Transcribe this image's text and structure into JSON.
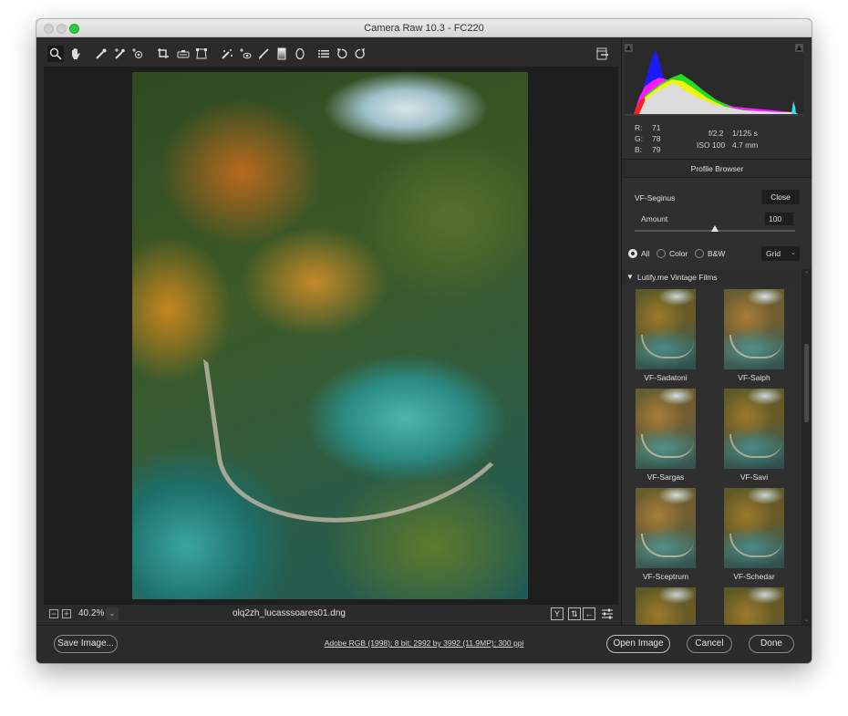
{
  "window": {
    "title": "Camera Raw 10.3  -  FC220"
  },
  "toolbar": {
    "tools": [
      {
        "name": "zoom-tool",
        "glyph": "🔍︎",
        "active": true
      },
      {
        "name": "hand-tool",
        "glyph": "✋︎"
      },
      {
        "name": "white-balance-tool",
        "glyph": "⁄"
      },
      {
        "name": "color-sampler-tool",
        "glyph": "⁄"
      },
      {
        "name": "targeted-adjustment-tool",
        "glyph": "⊙"
      },
      {
        "name": "crop-tool",
        "glyph": "⌗"
      },
      {
        "name": "straighten-tool",
        "glyph": "▭"
      },
      {
        "name": "transform-tool",
        "glyph": "⌑"
      },
      {
        "name": "spot-removal-tool",
        "glyph": "⁄"
      },
      {
        "name": "red-eye-tool",
        "glyph": "+o"
      },
      {
        "name": "adjustment-brush-tool",
        "glyph": "/"
      },
      {
        "name": "graduated-filter-tool",
        "glyph": "▮"
      },
      {
        "name": "radial-filter-tool",
        "glyph": "◯"
      },
      {
        "name": "preferences-tool",
        "glyph": "☰"
      },
      {
        "name": "rotate-left-tool",
        "glyph": "↺"
      },
      {
        "name": "rotate-right-tool",
        "glyph": "↻"
      }
    ],
    "toggle_fullscreen_glyph": "⇥"
  },
  "preview": {
    "zoom_out_glyph": "−",
    "zoom_in_glyph": "+",
    "zoom_level": "40.2%",
    "zoom_dropdown_glyph": "⌄",
    "filename": "olq2zh_lucasssoares01.dng",
    "view_buttons": [
      {
        "name": "before-after-view-button",
        "glyph": "Y"
      },
      {
        "name": "swap-before-after-button",
        "glyph": "⇅"
      },
      {
        "name": "copy-settings-button",
        "glyph": "←"
      },
      {
        "name": "toggle-settings-button",
        "glyph": "☷"
      }
    ]
  },
  "histogram": {
    "shadow_clip_glyph": "▲",
    "highlight_clip_glyph": "▲"
  },
  "readout": {
    "r_label": "R:",
    "r_value": "71",
    "g_label": "G:",
    "g_value": "78",
    "b_label": "B:",
    "b_value": "79",
    "aperture": "f/2.2",
    "shutter": "1/125 s",
    "iso": "ISO 100",
    "focal_length": "4.7 mm"
  },
  "profile_browser": {
    "title": "Profile Browser",
    "profile_name": "VF-Seginus",
    "close_label": "Close",
    "amount_label": "Amount",
    "amount_value": "100",
    "amount_fraction": 0.5,
    "filters": [
      {
        "label": "All",
        "checked": true
      },
      {
        "label": "Color",
        "checked": false
      },
      {
        "label": "B&W",
        "checked": false
      }
    ],
    "view_mode": "Grid",
    "view_mode_chevron": "⌄",
    "group": {
      "expand_glyph": "▼",
      "label": "Lutify.me Vintage Films"
    },
    "profiles": [
      {
        "label": "VF-Sadatoni"
      },
      {
        "label": "VF-Saiph"
      },
      {
        "label": "VF-Sargas"
      },
      {
        "label": "VF-Savi"
      },
      {
        "label": "VF-Sceptrum"
      },
      {
        "label": "VF-Schedar"
      },
      {
        "label": ""
      },
      {
        "label": ""
      }
    ],
    "scroll_up_glyph": "⌃",
    "scroll_down_glyph": "⌄"
  },
  "footer": {
    "save_label": "Save Image...",
    "workflow_options": "Adobe RGB (1998); 8 bit; 2992 by 3992 (11.9MP); 300 ppi",
    "open_label": "Open Image",
    "cancel_label": "Cancel",
    "done_label": "Done"
  }
}
